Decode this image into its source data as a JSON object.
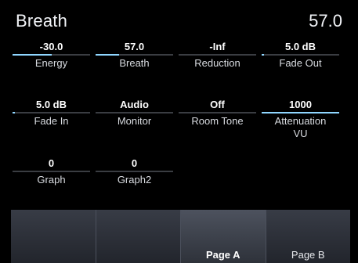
{
  "header": {
    "title": "Breath",
    "value": "57.0"
  },
  "params": [
    {
      "value": "-30.0",
      "label": "Energy",
      "level": 0.5
    },
    {
      "value": "57.0",
      "label": "Breath",
      "level": 0.3
    },
    {
      "value": "-Inf",
      "label": "Reduction",
      "level": 0
    },
    {
      "value": "5.0 dB",
      "label": "Fade Out",
      "level": 0.03
    },
    {
      "value": "5.0 dB",
      "label": "Fade In",
      "level": 0.03
    },
    {
      "value": "Audio",
      "label": "Monitor",
      "level": 0
    },
    {
      "value": "Off",
      "label": "Room Tone",
      "level": 0
    },
    {
      "value": "1000",
      "label": "Attenuation VU",
      "level": 1.0
    },
    {
      "value": "0",
      "label": "Graph",
      "level": 0
    },
    {
      "value": "0",
      "label": "Graph2",
      "level": 0
    }
  ],
  "softkeys": [
    {
      "label": ""
    },
    {
      "label": ""
    },
    {
      "label": "Page A"
    },
    {
      "label": "Page B"
    }
  ],
  "colors": {
    "accent": "#8fd6ff",
    "background": "#000000",
    "softkey_bg": "#2b2f38"
  }
}
